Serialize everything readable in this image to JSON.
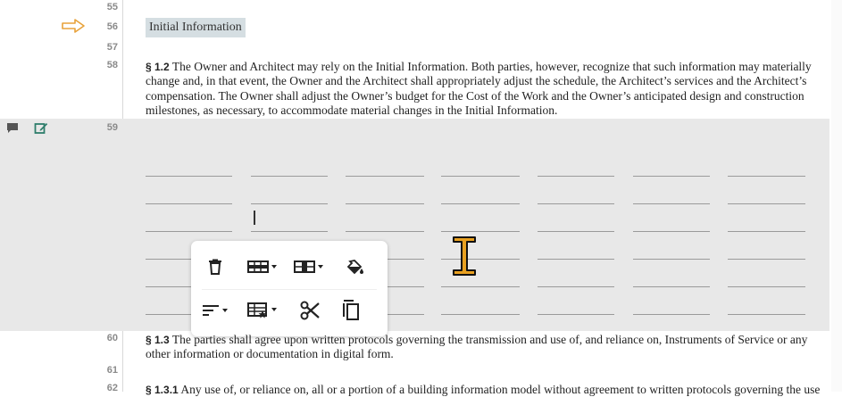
{
  "line_numbers": {
    "n55": "55",
    "n56": "56",
    "n57": "57",
    "n58": "58",
    "n59": "59",
    "n60": "60",
    "n61": "61",
    "n62": "62"
  },
  "document": {
    "heading": "Initial Information",
    "section_1_2": {
      "label": "§ 1.2",
      "text": " The Owner and Architect may rely on the Initial Information. Both parties, however, recognize that such information may materially change and, in that event, the Owner and the Architect shall appropriately adjust the schedule, the Architect’s services and the Architect’s compensation. The Owner shall adjust the Owner’s budget for the Cost of the Work and the Owner’s anticipated design and construction milestones, as necessary, to accommodate material changes in the Initial Information."
    },
    "section_1_3": {
      "label": "§ 1.3",
      "text": " The parties shall agree upon written protocols governing the transmission and use of, and reliance on, Instruments of Service or any other information or documentation in digital form."
    },
    "section_1_3_1": {
      "label": "§ 1.3.1",
      "text": " Any use of, or reliance on, all or a portion of a building information model without agreement to written protocols governing the use"
    }
  },
  "table_blanks": {
    "columns": 7,
    "rows": 6
  },
  "toolbar": {
    "row1": [
      "delete-table-icon",
      "insert-row-icon",
      "insert-column-icon",
      "fill-color-icon"
    ],
    "row2": [
      "align-icon",
      "table-style-icon",
      "cut-icon",
      "copy-icon"
    ]
  },
  "colors": {
    "band": "#e8e8e8",
    "heading_chip": "#d5dee2",
    "arrow": "#e8a23a",
    "edit_icon": "#2e7d6b"
  }
}
